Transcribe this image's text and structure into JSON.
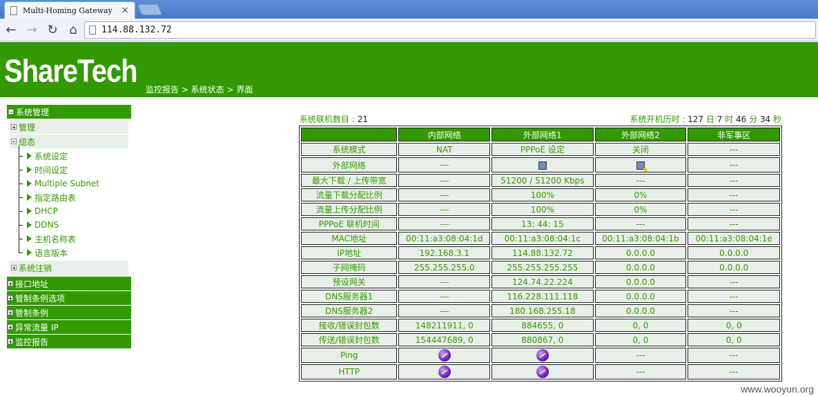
{
  "browser": {
    "tab_title": "Multi-Homing Gateway",
    "tab_close": "×",
    "url": "114.88.132.72",
    "back": "←",
    "forward": "→",
    "reload": "↻",
    "home": "⌂"
  },
  "banner": {
    "logo": "ShareTech",
    "breadcrumb": "监控报告 > 系统状态 > 界面"
  },
  "sidebar": {
    "system_mgmt": "系统管理",
    "manage": "管理",
    "config": "组态",
    "config_items": [
      "系统设定",
      "时间设定",
      "Multiple Subnet",
      "指定路由表",
      "DHCP",
      "DDNS",
      "主机名称表",
      "语言版本"
    ],
    "logout": "系统注销",
    "main_items": [
      "接口地址",
      "管制条例选项",
      "管制条例",
      "异常流量 IP",
      "监控报告"
    ]
  },
  "info": {
    "online_label": "系统联机数目 : ",
    "online_count": "21",
    "uptime_label": "系统开机历时 : ",
    "uptime_days": "127",
    "days_unit": " 日 ",
    "uptime_hours": "7",
    "hours_unit": " 时 ",
    "uptime_minutes": "46",
    "minutes_unit": " 分 ",
    "uptime_seconds": "34",
    "seconds_unit": " 秒"
  },
  "table": {
    "headers": [
      "",
      "内部网络",
      "外部网络1",
      "外部网络2",
      "非军事区"
    ],
    "rows": [
      [
        "系统模式",
        "NAT",
        "PPPoE 设定",
        "关闭",
        "---"
      ],
      [
        "外部网络",
        "---",
        "",
        "",
        "---"
      ],
      [
        "最大下载 / 上传带宽",
        "---",
        "51200 / 51200 Kbps",
        "---",
        "---"
      ],
      [
        "流量下载分配比例",
        "---",
        "100%",
        "0%",
        "---"
      ],
      [
        "流量上传分配比例",
        "---",
        "100%",
        "0%",
        "---"
      ],
      [
        "PPPoE 联机时间",
        "---",
        "13: 44: 15",
        "---",
        "---"
      ],
      [
        "MAC地址",
        "00:11:a3:08:04:1d",
        "00:11:a3:08:04:1c",
        "00:11:a3:08:04:1b",
        "00:11:a3:08:04:1e"
      ],
      [
        "IP地址",
        "192.168.3.1",
        "114.88.132.72",
        "0.0.0.0",
        "0.0.0.0"
      ],
      [
        "子网掩码",
        "255.255.255.0",
        "255.255.255.255",
        "0.0.0.0",
        "0.0.0.0"
      ],
      [
        "预设网关",
        "---",
        "124.74.22.224",
        "0.0.0.0",
        "---"
      ],
      [
        "DNS服务器1",
        "---",
        "116.228.111.118",
        "0.0.0.0",
        "---"
      ],
      [
        "DNS服务器2",
        "---",
        "180.168.255.18",
        "0.0.0.0",
        "---"
      ],
      [
        "接收/错误封包数",
        "148211911, 0",
        "884655, 0",
        "0, 0",
        "0, 0"
      ],
      [
        "传送/错误封包数",
        "154447689, 0",
        "880867, 0",
        "0, 0",
        "0, 0"
      ],
      [
        "Ping",
        "",
        "",
        "---",
        "---"
      ],
      [
        "HTTP",
        "",
        "",
        "---",
        "---"
      ]
    ]
  },
  "icons": {
    "ext1_network": "network-connected-icon",
    "ext2_network": "network-warning-icon",
    "ping_tool": "ping-tool-icon",
    "http_tool": "http-tool-icon"
  },
  "watermark": "www.wooyun.org",
  "colors": {
    "brand_green": "#339900",
    "cell_bg": "#e8efe8"
  }
}
